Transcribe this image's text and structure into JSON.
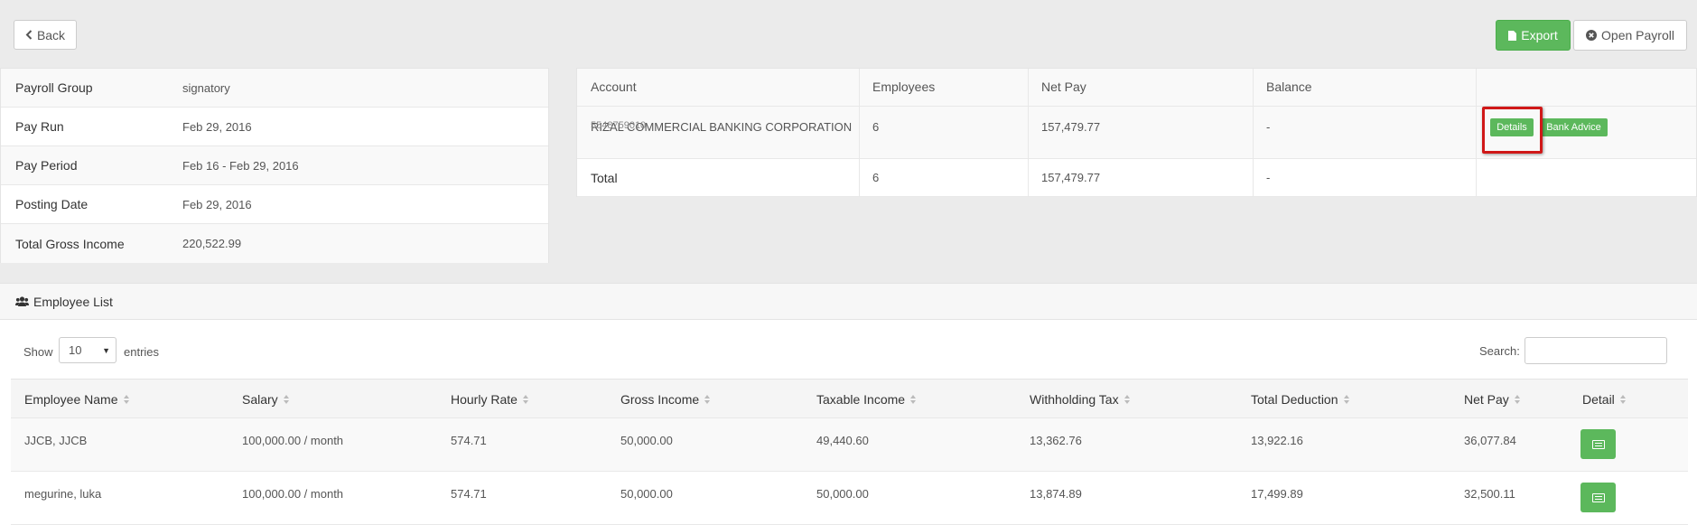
{
  "toolbar": {
    "back_label": "Back",
    "export_label": "Export",
    "open_payroll_label": "Open Payroll"
  },
  "summary": [
    {
      "label": "Payroll Group",
      "value": "signatory"
    },
    {
      "label": "Pay Run",
      "value": "Feb 29, 2016"
    },
    {
      "label": "Pay Period",
      "value": "Feb 16 - Feb 29, 2016"
    },
    {
      "label": "Posting Date",
      "value": "Feb 29, 2016"
    },
    {
      "label": "Total Gross Income",
      "value": "220,522.99"
    }
  ],
  "accounts": {
    "headers": {
      "account": "Account",
      "employees": "Employees",
      "net_pay": "Net Pay",
      "balance": "Balance"
    },
    "row": {
      "name": "RIZAL COMMERCIAL BANKING CORPORATION",
      "number": "5548759010",
      "employees": "6",
      "net_pay": "157,479.77",
      "balance": "-",
      "details_label": "Details",
      "bank_advice_label": "Bank Advice"
    },
    "total": {
      "label": "Total",
      "employees": "6",
      "net_pay": "157,479.77",
      "balance": "-"
    }
  },
  "employee_list": {
    "title": "Employee List",
    "show_label": "Show",
    "page_length": "10",
    "entries_label": "entries",
    "search_label": "Search:",
    "search_value": "",
    "columns": [
      "Employee Name",
      "Salary",
      "Hourly Rate",
      "Gross Income",
      "Taxable Income",
      "Withholding Tax",
      "Total Deduction",
      "Net Pay",
      "Detail"
    ],
    "rows": [
      {
        "name": "JJCB, JJCB",
        "salary": "100,000.00 / month",
        "hourly_rate": "574.71",
        "gross_income": "50,000.00",
        "taxable_income": "49,440.60",
        "withholding_tax": "13,362.76",
        "total_deduction": "13,922.16",
        "net_pay": "36,077.84"
      },
      {
        "name": "megurine, luka",
        "salary": "100,000.00 / month",
        "hourly_rate": "574.71",
        "gross_income": "50,000.00",
        "taxable_income": "50,000.00",
        "withholding_tax": "13,874.89",
        "total_deduction": "17,499.89",
        "net_pay": "32,500.11"
      }
    ]
  },
  "colors": {
    "accent_green": "#5cb85c",
    "highlight_red": "#d01818",
    "background": "#ebebeb"
  },
  "icons": [
    "chevron-left-icon",
    "file-icon",
    "times-circle-icon",
    "users-icon",
    "caret-down-icon",
    "sort-icon",
    "list-alt-icon"
  ]
}
